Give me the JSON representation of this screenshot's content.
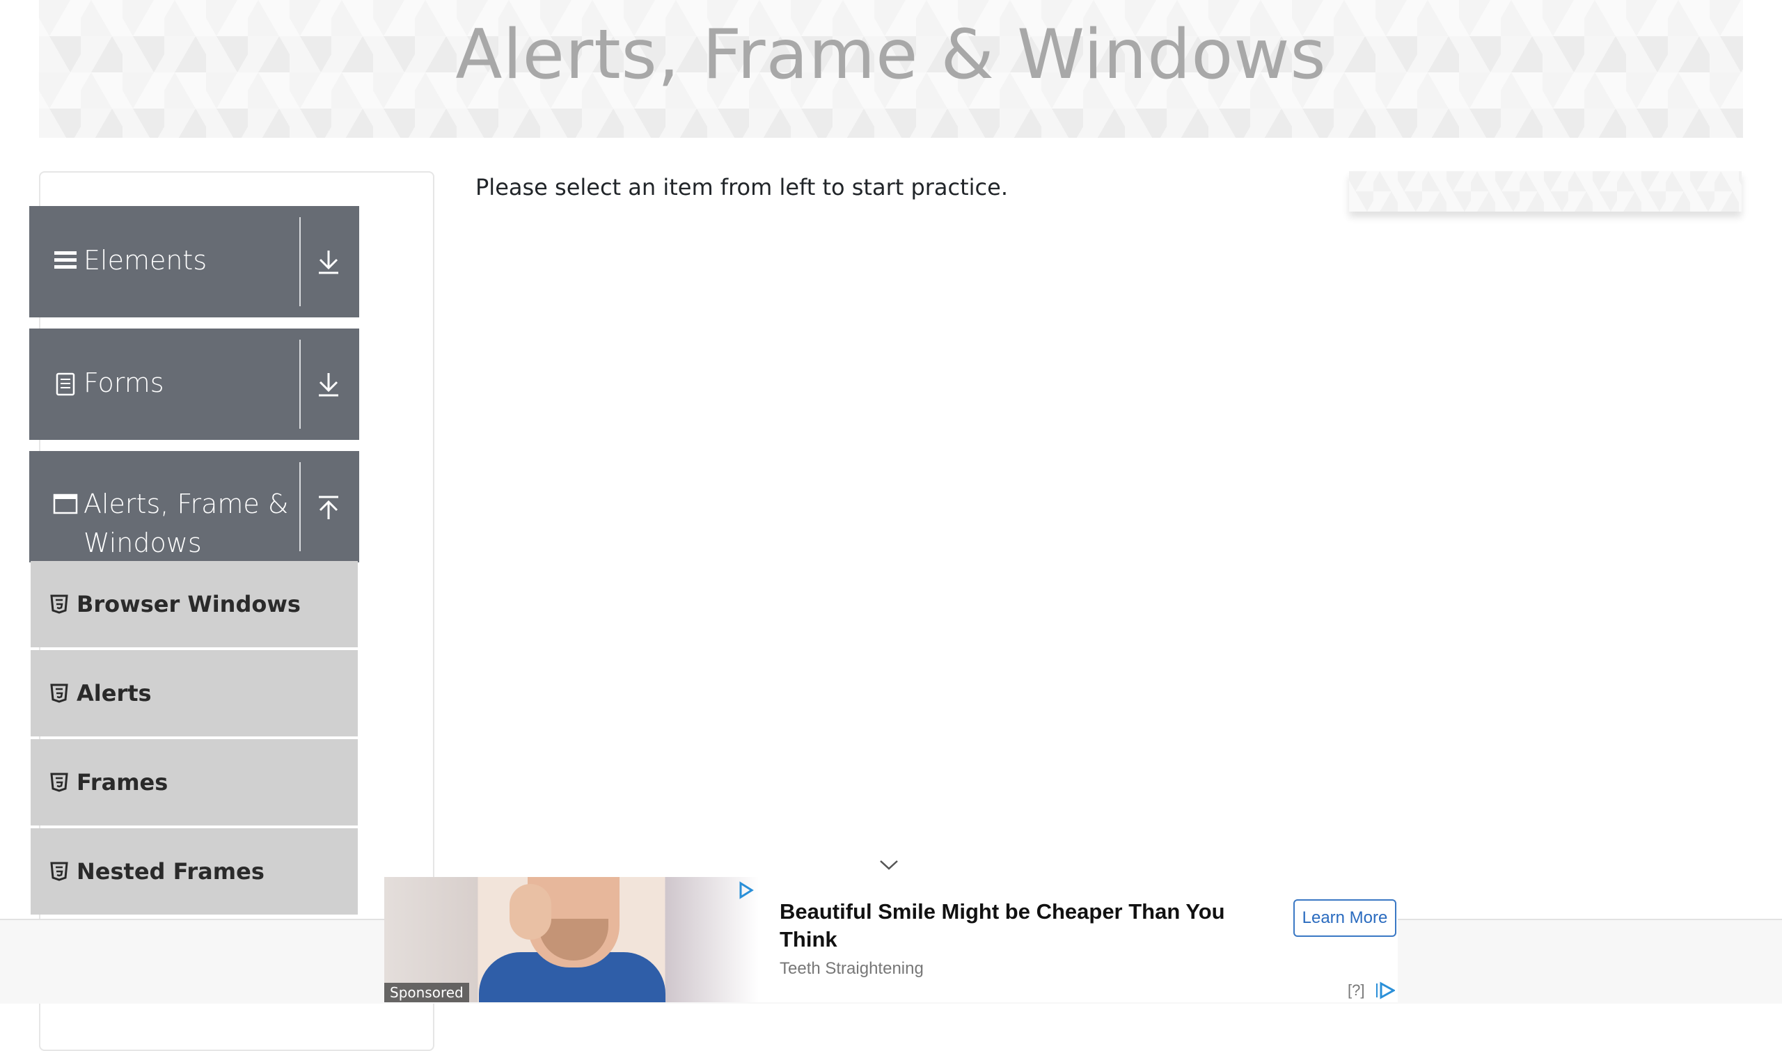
{
  "header": {
    "title": "Alerts, Frame & Windows"
  },
  "main": {
    "intro_text": "Please select an item from left to start practice."
  },
  "sidebar": {
    "groups": [
      {
        "label": "Elements",
        "icon": "hamburger-icon",
        "state": "collapsed"
      },
      {
        "label": "Forms",
        "icon": "form-icon",
        "state": "collapsed"
      },
      {
        "label_line1": "Alerts, Frame &",
        "label_line2": "Windows",
        "icon": "window-icon",
        "state": "expanded"
      }
    ],
    "items": [
      {
        "label": "Browser Windows",
        "icon": "html5-icon"
      },
      {
        "label": "Alerts",
        "icon": "html5-icon"
      },
      {
        "label": "Frames",
        "icon": "html5-icon"
      },
      {
        "label": "Nested Frames",
        "icon": "html5-icon"
      }
    ]
  },
  "ad": {
    "sponsored_label": "Sponsored",
    "title": "Beautiful Smile Might be Cheaper Than You Think",
    "subtitle": "Teeth Straightening",
    "cta_label": "Learn More",
    "info_label": "[?]",
    "colors": {
      "cta": "#2a6bbf",
      "sidebar_group": "#676c74",
      "sidebar_item": "#d0d0d0"
    }
  }
}
